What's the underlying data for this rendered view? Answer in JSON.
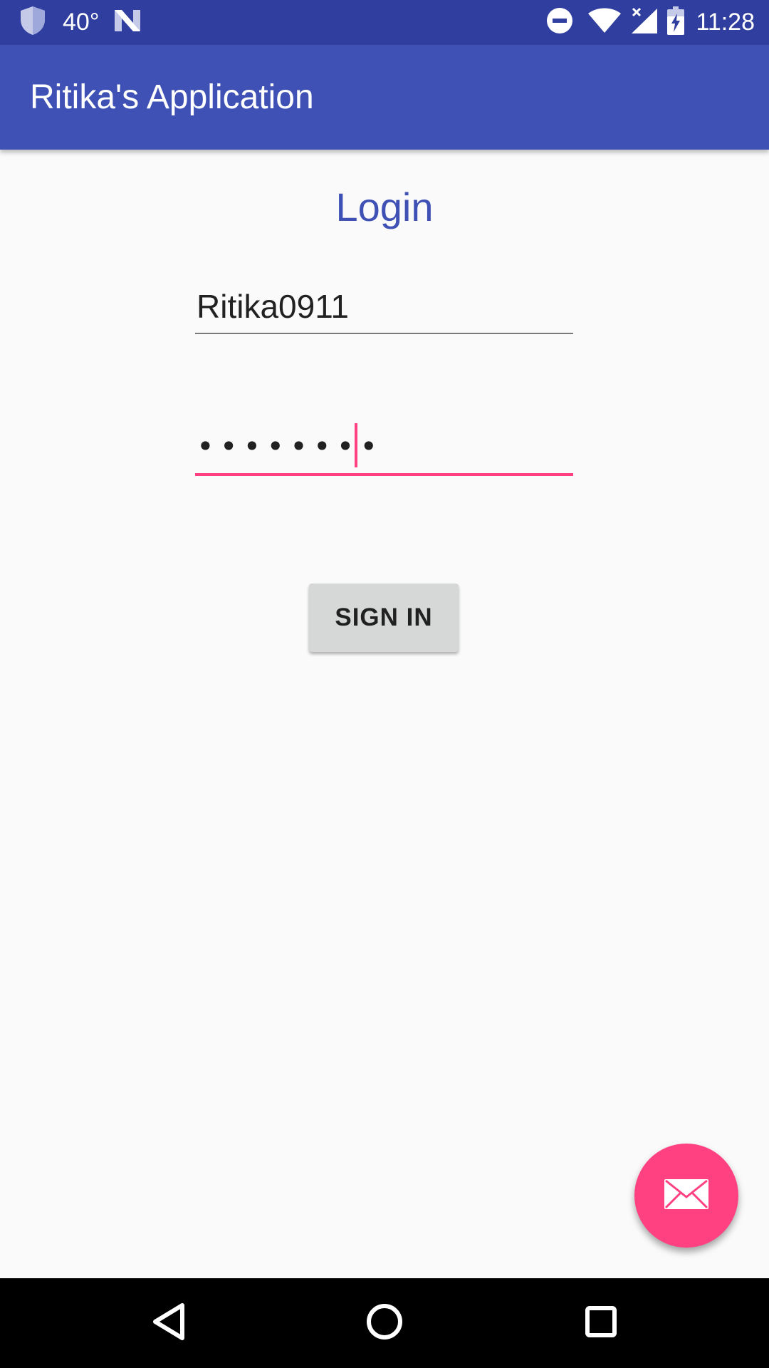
{
  "status_bar": {
    "temperature": "40°",
    "time": "11:28",
    "icons": [
      "shield-icon",
      "n-notification-icon",
      "do-not-disturb-icon",
      "wifi-icon",
      "signal-no-data-icon",
      "battery-charging-icon"
    ]
  },
  "app_bar": {
    "title": "Ritika's Application"
  },
  "login": {
    "title": "Login",
    "username_value": "Ritika0911",
    "password_value": "••••••••",
    "sign_in_label": "SIGN IN"
  },
  "fab": {
    "icon": "mail-icon"
  },
  "nav_bar": {
    "icons": [
      "back-icon",
      "home-icon",
      "recents-icon"
    ]
  },
  "colors": {
    "status_bar": "#303F9F",
    "primary": "#3F51B5",
    "accent": "#FF4081",
    "background": "#FAFAFA",
    "button": "#D6D7D7"
  }
}
